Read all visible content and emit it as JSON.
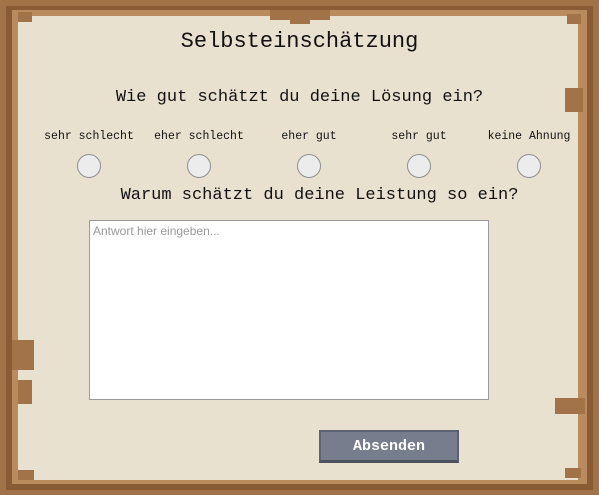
{
  "title": "Selbsteinschätzung",
  "question1": "Wie gut schätzt du deine Lösung ein?",
  "rating_options": [
    {
      "label": "sehr schlecht"
    },
    {
      "label": "eher schlecht"
    },
    {
      "label": "eher gut"
    },
    {
      "label": "sehr gut"
    },
    {
      "label": "keine Ahnung"
    }
  ],
  "question2": "Warum schätzt du deine Leistung so ein?",
  "answer": {
    "placeholder": "Antwort hier eingeben...",
    "value": ""
  },
  "submit_label": "Absenden",
  "colors": {
    "parchment": "#e9e1cf",
    "frame": "#a27249",
    "button": "#777d8c"
  }
}
